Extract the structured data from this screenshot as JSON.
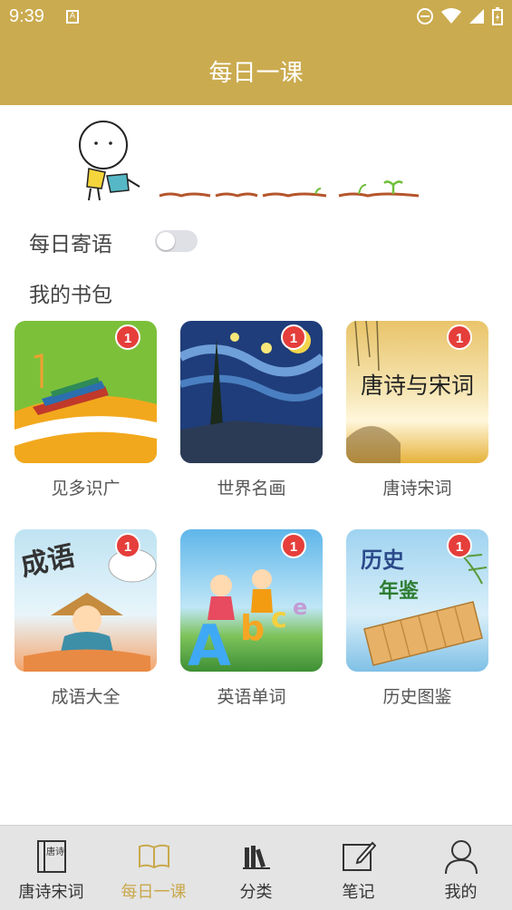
{
  "status_bar": {
    "time": "9:39",
    "notification_icon": "A"
  },
  "app_bar": {
    "title": "每日一课"
  },
  "daily_message": {
    "label": "每日寄语",
    "toggle_on": false
  },
  "bookbag": {
    "title": "我的书包",
    "books": [
      {
        "title": "见多识广",
        "badge": "1"
      },
      {
        "title": "世界名画",
        "badge": "1"
      },
      {
        "title": "唐诗宋词",
        "badge": "1",
        "cover_text": "唐诗与宋词"
      },
      {
        "title": "成语大全",
        "badge": "1",
        "cover_text": "成语"
      },
      {
        "title": "英语单词",
        "badge": "1"
      },
      {
        "title": "历史图鉴",
        "badge": "1",
        "cover_text": "历史",
        "cover_text_2": "年鉴"
      }
    ]
  },
  "tab_bar": {
    "tabs": [
      {
        "label": "唐诗宋词",
        "icon": "book-poem-icon",
        "icon_text": "唐诗"
      },
      {
        "label": "每日一课",
        "icon": "open-book-icon",
        "active": true
      },
      {
        "label": "分类",
        "icon": "bookshelf-icon"
      },
      {
        "label": "笔记",
        "icon": "note-edit-icon"
      },
      {
        "label": "我的",
        "icon": "person-icon"
      }
    ]
  },
  "colors": {
    "accent": "#cbab4f",
    "badge": "#e53e3b",
    "tab_active": "#c9a84c"
  }
}
